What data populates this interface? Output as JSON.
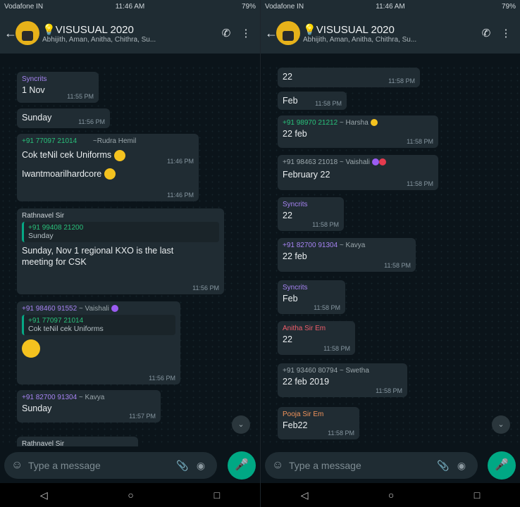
{
  "status": {
    "carrier": "Vodafone IN",
    "time": "11:46 AM",
    "battery": "79%"
  },
  "header": {
    "title": "VISUSUAL 2020",
    "members": "Abhijith, Aman, Anitha, Chithra, Su..."
  },
  "colors": {
    "header_bg": "#1f2c33",
    "chat_bg": "#0b141a",
    "bubble_bg": "#202c33",
    "accent": "#00a884",
    "sender_green": "#29c07a",
    "sender_purple": "#a683f2",
    "sender_red": "#ef5d6a",
    "sender_orange": "#f0935b"
  },
  "left": {
    "messages": [
      {
        "sender": "Syncrits",
        "text": "1 Nov",
        "time": "11:55 PM"
      },
      {
        "sender": "",
        "text": "Sunday",
        "time": "11:56 PM"
      },
      {
        "sender": "+91 77097 21014",
        "alias": "~Rudra Hemil",
        "text": "Cok teNil cek Uniforms",
        "time": "11:46 PM"
      },
      {
        "sender": "",
        "text": "Iwantmoarilhardcore",
        "time": "11:46 PM"
      },
      {
        "sender": "Rathnavel Sir",
        "quote_name": "+91 99408 21200",
        "quote_text": "Sunday",
        "text": "Sunday, Nov 1 regional KXO is the last meeting for CSK",
        "time": "11:56 PM"
      },
      {
        "sender": "+91 98460 91552",
        "alias": "~ Vaishali",
        "quote_name": "+91 77097 21014",
        "quote_text": "Cok teNil cek Uniforms",
        "text": "",
        "time": "11:56 PM"
      },
      {
        "sender": "+91 82700 91304",
        "alias": "~ Kavya",
        "text": "Sunday",
        "time": "11:57 PM"
      },
      {
        "sender": "Rathnavel Sir",
        "text": "",
        "time": ""
      }
    ],
    "composer_placeholder": "Type a message"
  },
  "right": {
    "messages": [
      {
        "sender": "",
        "text": "22",
        "time": "11:58 PM"
      },
      {
        "sender": "",
        "text": "Feb",
        "time": "11:58 PM"
      },
      {
        "sender": "+91 98970 21212",
        "alias": "~ Harsha",
        "text": "22 feb",
        "time": "11:58 PM"
      },
      {
        "sender": "+91 98463 21018",
        "alias": "~ Vaishali",
        "text": "February 22",
        "time": "11:58 PM"
      },
      {
        "sender": "Syncrits",
        "text": "22",
        "time": "11:58 PM"
      },
      {
        "sender": "+91 82700 91304",
        "alias": "~ Kavya",
        "text": "22 feb",
        "time": "11:58 PM"
      },
      {
        "sender": "Syncrits",
        "text": "Feb",
        "time": "11:58 PM"
      },
      {
        "sender": "Anitha Sir Em",
        "text": "22",
        "time": "11:58 PM"
      },
      {
        "sender": "+91 93460 80794",
        "alias": "~ Swetha",
        "text": "22 feb 2019",
        "time": "11:58 PM"
      },
      {
        "sender": "Pooja Sir Em",
        "text": "Feb22",
        "time": "11:58 PM"
      }
    ],
    "composer_placeholder": "Type a message"
  },
  "nav": {
    "back": "◁",
    "home": "○",
    "recents": "□"
  }
}
